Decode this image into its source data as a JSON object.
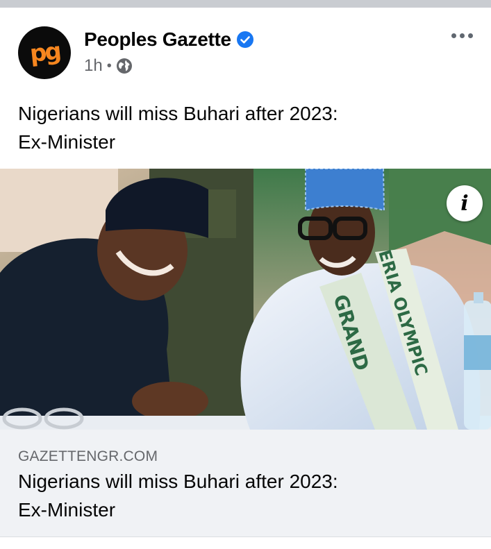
{
  "post": {
    "page_name": "Peoples Gazette",
    "avatar_text": "pg",
    "time_ago": "1h",
    "separator": "•",
    "audience_icon": "globe-icon",
    "verified_icon": "verified-badge-icon",
    "more_icon": "more-horizontal-icon",
    "text_lines": [
      "Nigerians will miss Buhari after 2023:",
      "Ex-Minister"
    ]
  },
  "image": {
    "info_icon": "info-icon",
    "info_glyph": "i",
    "sash_text_1": "ERIA OLYMPIC",
    "sash_text_2": "GRAND"
  },
  "link_preview": {
    "domain": "GAZETTENGR.COM",
    "title_lines": [
      "Nigerians will miss Buhari after 2023:",
      "Ex-Minister"
    ]
  },
  "colors": {
    "verified_blue": "#1877f2",
    "brand_orange": "#f6861f",
    "meta_gray": "#65676b",
    "preview_bg": "#f0f2f5"
  }
}
